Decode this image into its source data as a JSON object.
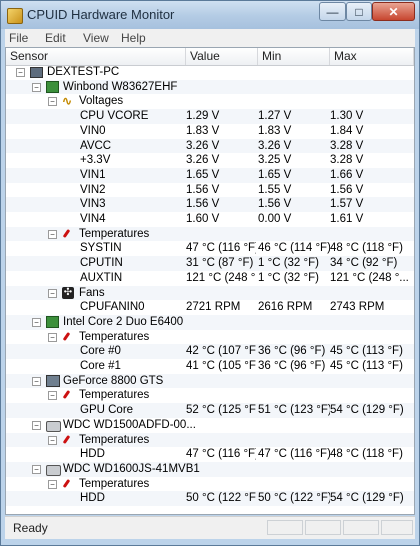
{
  "window": {
    "title": "CPUID Hardware Monitor",
    "min_glyph": "—",
    "max_glyph": "□",
    "close_glyph": "✕"
  },
  "menu": [
    "File",
    "Edit",
    "View",
    "Help"
  ],
  "columns": {
    "sensor": "Sensor",
    "value": "Value",
    "min": "Min",
    "max": "Max"
  },
  "rows": [
    {
      "level": 0,
      "kind": "node",
      "icon": "pc",
      "exp": "−",
      "label": "DEXTEST-PC",
      "value": "",
      "min": "",
      "max": ""
    },
    {
      "level": 1,
      "kind": "node",
      "icon": "chip-board",
      "exp": "−",
      "label": "Winbond W83627EHF",
      "value": "",
      "min": "",
      "max": ""
    },
    {
      "level": 2,
      "kind": "group",
      "icon": "voltage",
      "exp": "−",
      "label": "Voltages",
      "value": "",
      "min": "",
      "max": ""
    },
    {
      "level": 3,
      "kind": "leaf",
      "icon": "",
      "exp": "",
      "label": "CPU VCORE",
      "value": "1.29 V",
      "min": "1.27 V",
      "max": "1.30 V"
    },
    {
      "level": 3,
      "kind": "leaf",
      "icon": "",
      "exp": "",
      "label": "VIN0",
      "value": "1.83 V",
      "min": "1.83 V",
      "max": "1.84 V"
    },
    {
      "level": 3,
      "kind": "leaf",
      "icon": "",
      "exp": "",
      "label": "AVCC",
      "value": "3.26 V",
      "min": "3.26 V",
      "max": "3.28 V"
    },
    {
      "level": 3,
      "kind": "leaf",
      "icon": "",
      "exp": "",
      "label": "+3.3V",
      "value": "3.26 V",
      "min": "3.25 V",
      "max": "3.28 V"
    },
    {
      "level": 3,
      "kind": "leaf",
      "icon": "",
      "exp": "",
      "label": "VIN1",
      "value": "1.65 V",
      "min": "1.65 V",
      "max": "1.66 V"
    },
    {
      "level": 3,
      "kind": "leaf",
      "icon": "",
      "exp": "",
      "label": "VIN2",
      "value": "1.56 V",
      "min": "1.55 V",
      "max": "1.56 V"
    },
    {
      "level": 3,
      "kind": "leaf",
      "icon": "",
      "exp": "",
      "label": "VIN3",
      "value": "1.56 V",
      "min": "1.56 V",
      "max": "1.57 V"
    },
    {
      "level": 3,
      "kind": "leaf",
      "icon": "",
      "exp": "",
      "label": "VIN4",
      "value": "1.60 V",
      "min": "0.00 V",
      "max": "1.61 V"
    },
    {
      "level": 2,
      "kind": "group",
      "icon": "temperature",
      "exp": "−",
      "label": "Temperatures",
      "value": "",
      "min": "",
      "max": ""
    },
    {
      "level": 3,
      "kind": "leaf",
      "icon": "",
      "exp": "",
      "label": "SYSTIN",
      "value": "47 °C  (116 °F)",
      "min": "46 °C  (114 °F)",
      "max": "48 °C  (118 °F)"
    },
    {
      "level": 3,
      "kind": "leaf",
      "icon": "",
      "exp": "",
      "label": "CPUTIN",
      "value": "31 °C  (87 °F)",
      "min": "1 °C  (32 °F)",
      "max": "34 °C  (92 °F)"
    },
    {
      "level": 3,
      "kind": "leaf",
      "icon": "",
      "exp": "",
      "label": "AUXTIN",
      "value": "121 °C  (248 °...",
      "min": "1 °C  (32 °F)",
      "max": "121 °C  (248 °..."
    },
    {
      "level": 2,
      "kind": "group",
      "icon": "fan",
      "exp": "−",
      "label": "Fans",
      "value": "",
      "min": "",
      "max": ""
    },
    {
      "level": 3,
      "kind": "leaf",
      "icon": "",
      "exp": "",
      "label": "CPUFANIN0",
      "value": "2721 RPM",
      "min": "2616 RPM",
      "max": "2743 RPM"
    },
    {
      "level": 1,
      "kind": "node",
      "icon": "cpu-chip",
      "exp": "−",
      "label": "Intel Core 2 Duo E6400",
      "value": "",
      "min": "",
      "max": ""
    },
    {
      "level": 2,
      "kind": "group",
      "icon": "temperature",
      "exp": "−",
      "label": "Temperatures",
      "value": "",
      "min": "",
      "max": ""
    },
    {
      "level": 3,
      "kind": "leaf",
      "icon": "",
      "exp": "",
      "label": "Core #0",
      "value": "42 °C  (107 °F)",
      "min": "36 °C  (96 °F)",
      "max": "45 °C  (113 °F)"
    },
    {
      "level": 3,
      "kind": "leaf",
      "icon": "",
      "exp": "",
      "label": "Core #1",
      "value": "41 °C  (105 °F)",
      "min": "36 °C  (96 °F)",
      "max": "45 °C  (113 °F)"
    },
    {
      "level": 1,
      "kind": "node",
      "icon": "gpu",
      "exp": "−",
      "label": "GeForce 8800 GTS",
      "value": "",
      "min": "",
      "max": ""
    },
    {
      "level": 2,
      "kind": "group",
      "icon": "temperature",
      "exp": "−",
      "label": "Temperatures",
      "value": "",
      "min": "",
      "max": ""
    },
    {
      "level": 3,
      "kind": "leaf",
      "icon": "",
      "exp": "",
      "label": "GPU Core",
      "value": "52 °C  (125 °F)",
      "min": "51 °C  (123 °F)",
      "max": "54 °C  (129 °F)"
    },
    {
      "level": 1,
      "kind": "node",
      "icon": "hard-drive",
      "exp": "−",
      "label": "WDC WD1500ADFD-00...",
      "value": "",
      "min": "",
      "max": ""
    },
    {
      "level": 2,
      "kind": "group",
      "icon": "temperature",
      "exp": "−",
      "label": "Temperatures",
      "value": "",
      "min": "",
      "max": ""
    },
    {
      "level": 3,
      "kind": "leaf",
      "icon": "",
      "exp": "",
      "label": "HDD",
      "value": "47 °C  (116 °F)",
      "min": "47 °C  (116 °F)",
      "max": "48 °C  (118 °F)"
    },
    {
      "level": 1,
      "kind": "node",
      "icon": "hard-drive",
      "exp": "−",
      "label": "WDC WD1600JS-41MVB1",
      "value": "",
      "min": "",
      "max": ""
    },
    {
      "level": 2,
      "kind": "group",
      "icon": "temperature",
      "exp": "−",
      "label": "Temperatures",
      "value": "",
      "min": "",
      "max": ""
    },
    {
      "level": 3,
      "kind": "leaf",
      "icon": "",
      "exp": "",
      "label": "HDD",
      "value": "50 °C  (122 °F)",
      "min": "50 °C  (122 °F)",
      "max": "54 °C  (129 °F)"
    }
  ],
  "status": {
    "text": "Ready"
  },
  "colors": {
    "alt_row": "#f3f6fa",
    "grid_line": "#eef0f3"
  }
}
